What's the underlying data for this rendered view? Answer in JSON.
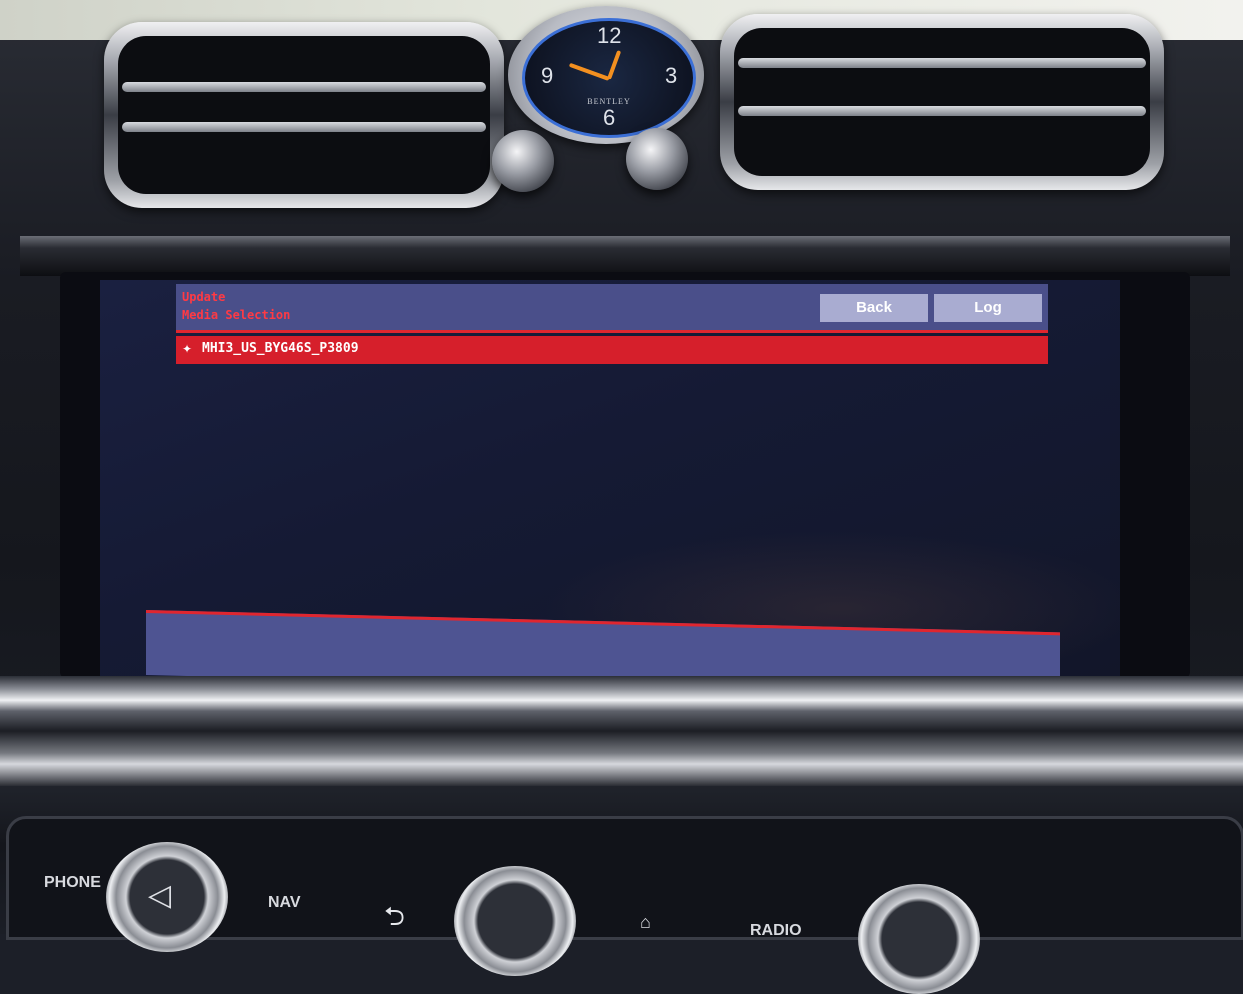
{
  "screen": {
    "header": {
      "title": "Update",
      "subtitle": "Media Selection",
      "back_label": "Back",
      "log_label": "Log"
    },
    "media_list": [
      {
        "bullet": "✦",
        "label": "MHI3_US_BYG46S_P3809"
      }
    ]
  },
  "clock": {
    "numbers": [
      "12",
      "3",
      "6",
      "9"
    ],
    "brand": "BENTLEY"
  },
  "control_panel": {
    "phone_label": "PHONE",
    "nav_label": "NAV",
    "radio_label": "RADIO"
  },
  "colors": {
    "header_bg": "#4a4f8a",
    "accent_red": "#d61f2b",
    "button_bg": "#a9acd1",
    "header_text": "#ff3a44"
  },
  "icons": {
    "back": "back-arrow-icon",
    "volume": "triangle-play-icon",
    "home": "home-icon"
  }
}
